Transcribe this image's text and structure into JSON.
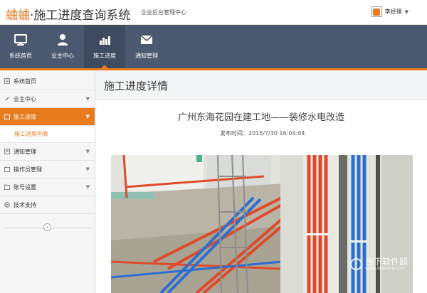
{
  "app": {
    "brand": "蛐蛐",
    "title": "·施工进度查询系统",
    "subtitle": "企业后台管理中心",
    "user_name": "李经理"
  },
  "nav": {
    "items": [
      {
        "label": "系统首页",
        "icon": "monitor-icon"
      },
      {
        "label": "业主中心",
        "icon": "user-icon"
      },
      {
        "label": "施工进度",
        "icon": "bar-chart-icon"
      },
      {
        "label": "通知管理",
        "icon": "mail-icon"
      }
    ],
    "active": "施工进度"
  },
  "sidebar": {
    "items": [
      {
        "label": "系统首页",
        "icon": "home-icon"
      },
      {
        "label": "业主中心",
        "icon": "edit-icon"
      },
      {
        "label": "施工进度",
        "icon": "folder-icon"
      },
      {
        "label": "施工进度列表",
        "icon": ""
      },
      {
        "label": "通知管理",
        "icon": "list-icon"
      },
      {
        "label": "操作员管理",
        "icon": "folder-icon"
      },
      {
        "label": "账号设置",
        "icon": "folder-icon"
      },
      {
        "label": "技术支持",
        "icon": "support-icon"
      }
    ],
    "collapse_glyph": "‹"
  },
  "content": {
    "header_title": "施工进度详情",
    "article_title": "广州东海花园在建工地——装修水电改造",
    "publish_time": "发布时间：2015/7/30 16:04:04"
  },
  "watermark": {
    "text": "当下软件园",
    "sub": "www.downxia.com"
  },
  "colors": {
    "accent": "#e87b1e",
    "navbar": "#4b5970",
    "pipe_red": "#e04a2a",
    "pipe_blue": "#2c6fd1"
  }
}
